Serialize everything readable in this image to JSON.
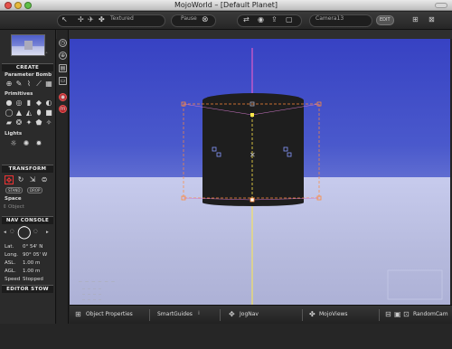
{
  "window": {
    "title": "MojoWorld – [Default Planet]"
  },
  "toolbar": {
    "render_mode": "Textured",
    "pause_label": "Pause",
    "camera_label": "Camera13",
    "edit_label": "EDIT"
  },
  "left_panel": {
    "create_label": "CREATE",
    "parameter_bomb_label": "Parameter Bomb",
    "primitives_label": "Primitives",
    "lights_label": "Lights",
    "transform_label": "TRANSFORM",
    "stand_label": "STAND",
    "drop_label": "DROP",
    "space_label": "Space",
    "space_value": "Object",
    "nav_console_label": "NAV CONSOLE",
    "nav": {
      "lat_label": "Lat.",
      "lat_value": "0° 54' N",
      "long_label": "Long.",
      "long_value": "90° 05' W",
      "asl_label": "ASL.",
      "asl_value": "1.00 m",
      "agl_label": "AGL.",
      "agl_value": "1.00 m",
      "speed_label": "Speed",
      "speed_value": "Stopped"
    },
    "editor_stow_label": "EDITOR STOW"
  },
  "bottom_bar": {
    "object_properties": "Object Properties",
    "smart_guides": "SmartGuides",
    "jog_nav": "JogNav",
    "mojo_views": "MojoViews",
    "random_cam": "RandomCam"
  },
  "colors": {
    "sky_top": "#3742c3",
    "ground": "#c0c4e8",
    "selection": "#ff8a3a",
    "axis_line": "#ff5fc8",
    "y_axis": "#ffe84a"
  }
}
